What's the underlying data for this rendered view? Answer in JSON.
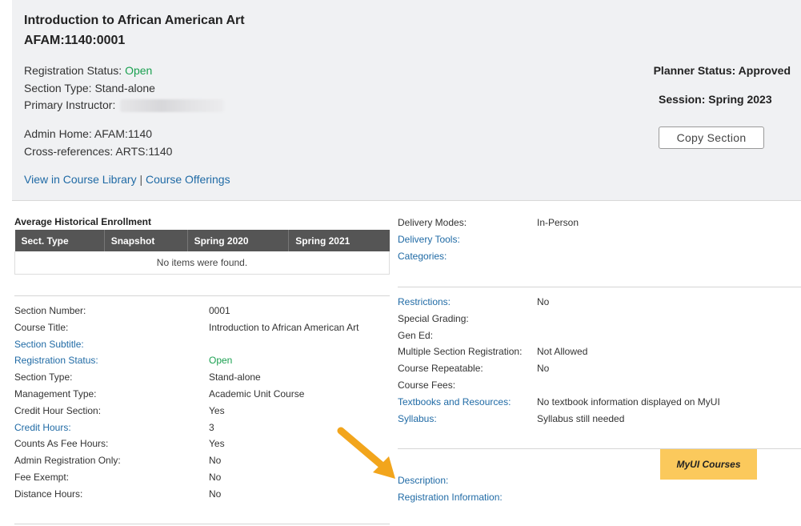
{
  "header": {
    "title": "Introduction to African American Art",
    "course_code": "AFAM:1140:0001",
    "registration_status_label": "Registration Status:",
    "registration_status_value": "Open",
    "section_type": "Section Type: Stand-alone",
    "primary_instructor_label": "Primary Instructor:",
    "admin_home": "Admin Home: AFAM:1140",
    "cross_references": "Cross-references: ARTS:1140",
    "link_course_library": "View in Course Library",
    "link_separator": "|",
    "link_course_offerings": "Course Offerings",
    "planner_status": "Planner Status: Approved",
    "session": "Session: Spring 2023",
    "copy_section_button": "Copy Section"
  },
  "enrollment": {
    "title": "Average Historical Enrollment",
    "columns": [
      "Sect. Type",
      "Snapshot",
      "Spring 2020",
      "Spring 2021"
    ],
    "empty_message": "No items were found."
  },
  "left_details": [
    {
      "label": "Section Number:",
      "value": "0001",
      "is_link": false
    },
    {
      "label": "Course Title:",
      "value": "Introduction to African American Art",
      "is_link": false
    },
    {
      "label": "Section Subtitle:",
      "value": "",
      "is_link": true
    },
    {
      "label": "Registration Status:",
      "value": "Open",
      "is_link": true,
      "value_color": "green"
    },
    {
      "label": "Section Type:",
      "value": "Stand-alone",
      "is_link": false
    },
    {
      "label": "Management Type:",
      "value": "Academic Unit Course",
      "is_link": false
    },
    {
      "label": "Credit Hour Section:",
      "value": "Yes",
      "is_link": false
    },
    {
      "label": "Credit Hours:",
      "value": "3",
      "is_link": true
    },
    {
      "label": "Counts As Fee Hours:",
      "value": "Yes",
      "is_link": false
    },
    {
      "label": "Admin Registration Only:",
      "value": "No",
      "is_link": false
    },
    {
      "label": "Fee Exempt:",
      "value": "No",
      "is_link": false
    },
    {
      "label": "Distance Hours:",
      "value": "No",
      "is_link": false
    }
  ],
  "right_details_1": [
    {
      "label": "Delivery Modes:",
      "value": "In-Person",
      "is_link": false
    },
    {
      "label": "Delivery Tools:",
      "value": "",
      "is_link": true
    },
    {
      "label": "Categories:",
      "value": "",
      "is_link": true
    }
  ],
  "right_details_2": [
    {
      "label": "Restrictions:",
      "value": "No",
      "is_link": true
    },
    {
      "label": "Special Grading:",
      "value": "",
      "is_link": false
    },
    {
      "label": "Gen Ed:",
      "value": "",
      "is_link": false
    },
    {
      "label": "Multiple Section Registration:",
      "value": "Not Allowed",
      "is_link": false
    },
    {
      "label": "Course Repeatable:",
      "value": "No",
      "is_link": false
    },
    {
      "label": "Course Fees:",
      "value": "",
      "is_link": false
    },
    {
      "label": "Textbooks and Resources:",
      "value": "No textbook information displayed on MyUI",
      "is_link": true
    },
    {
      "label": "Syllabus:",
      "value": "Syllabus still needed",
      "is_link": true
    }
  ],
  "right_details_3": [
    {
      "label": "Description:",
      "value": "",
      "is_link": true
    },
    {
      "label": "Registration Information:",
      "value": "",
      "is_link": true
    }
  ],
  "myui_button": "MyUI Courses",
  "colors": {
    "link": "#1f6aa5",
    "status_green": "#1aa050",
    "header_bg": "#f0f1f3",
    "table_header_bg": "#555555",
    "myui_button_bg": "#fbc95c",
    "arrow": "#f2a51c"
  }
}
